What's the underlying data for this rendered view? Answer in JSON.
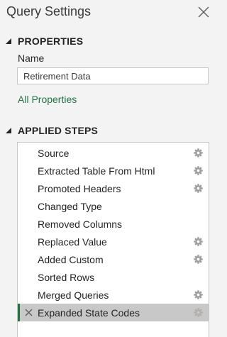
{
  "panel": {
    "title": "Query Settings"
  },
  "properties": {
    "header": "PROPERTIES",
    "name_label": "Name",
    "name_value": "Retirement Data",
    "all_properties_link": "All Properties"
  },
  "applied_steps": {
    "header": "APPLIED STEPS",
    "selected_step": "Expanded State Codes",
    "steps": [
      {
        "label": "Source",
        "has_settings": true
      },
      {
        "label": "Extracted Table From Html",
        "has_settings": true
      },
      {
        "label": "Promoted Headers",
        "has_settings": true
      },
      {
        "label": "Changed Type",
        "has_settings": false
      },
      {
        "label": "Removed Columns",
        "has_settings": false
      },
      {
        "label": "Replaced Value",
        "has_settings": true
      },
      {
        "label": "Added Custom",
        "has_settings": true
      },
      {
        "label": "Sorted Rows",
        "has_settings": false
      },
      {
        "label": "Merged Queries",
        "has_settings": true
      },
      {
        "label": "Expanded State Codes",
        "has_settings": true
      }
    ]
  },
  "icons": {
    "close": "close-icon",
    "collapse": "collapse-triangle-icon",
    "settings": "gear-icon",
    "delete": "delete-step-icon"
  },
  "colors": {
    "background": "#f3f3f3",
    "link": "#217346",
    "selected_row": "#c8c8c8",
    "selected_accent": "#217346"
  }
}
